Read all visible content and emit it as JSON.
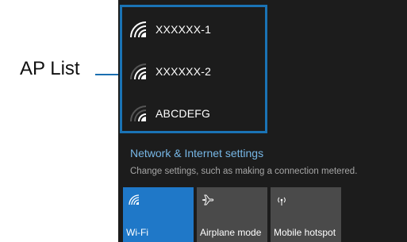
{
  "callout": {
    "label": "AP List"
  },
  "networks": [
    {
      "name": "XXXXXX-1",
      "icon": "wifi-icon"
    },
    {
      "name": "XXXXXX-2",
      "icon": "wifi-icon"
    },
    {
      "name": "ABCDEFG",
      "icon": "wifi-icon"
    }
  ],
  "settings": {
    "title": "Network & Internet settings",
    "subtitle": "Change settings, such as making a connection metered."
  },
  "tiles": [
    {
      "label": "Wi-Fi",
      "icon": "wifi-icon",
      "active": true
    },
    {
      "label": "Airplane mode",
      "icon": "airplane-icon",
      "active": false
    },
    {
      "label": "Mobile hotspot",
      "icon": "hotspot-icon",
      "active": false
    }
  ],
  "colors": {
    "accent": "#1f78c8",
    "link": "#77b7e6",
    "panel_bg": "#1c1c1c",
    "tile_bg": "#4a4a4a",
    "callout": "#1a73b5"
  }
}
